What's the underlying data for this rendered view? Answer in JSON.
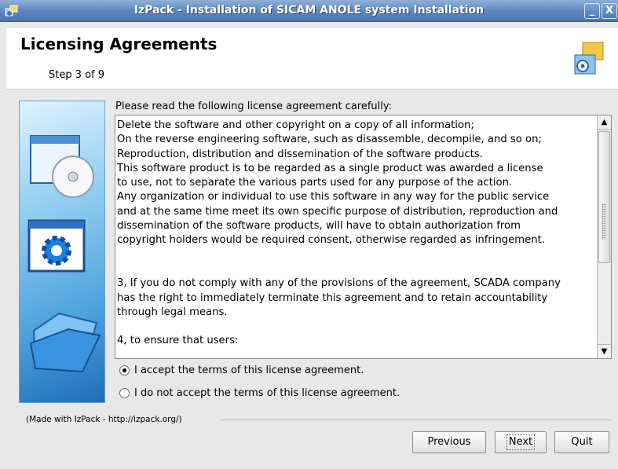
{
  "window": {
    "title": "IzPack - Installation of SICAM ANOLE system Installation",
    "minimize_label": "_",
    "close_label": "X"
  },
  "header": {
    "heading": "Licensing Agreements",
    "step": "Step 3 of 9"
  },
  "license": {
    "intro": "Please read the following license agreement carefully:",
    "text": "Delete the software and other copyright on a copy of all information;\nOn the reverse engineering software, such as disassemble, decompile, and so on;\nReproduction, distribution and dissemination of the software products.\nThis software product is to be regarded as a single product was awarded a license\nto use, not to separate the various parts used for any purpose of the action.\nAny organization or individual to use this software in any way for the public service\nand at the same time meet its own specific purpose of distribution, reproduction and\ndissemination of the software products, will have to obtain authorization from\ncopyright holders would be required consent, otherwise regarded as infringement.\n\n\n3, If you do not comply with any of the provisions of the agreement, SCADA company\nhas the right to immediately terminate this agreement and to retain accountability\nthrough legal means.\n\n4, to ensure that users:"
  },
  "options": {
    "accept_label": "I accept the terms of this license agreement.",
    "reject_label": "I do not accept the terms of this license agreement.",
    "selected": "accept"
  },
  "footer": {
    "made_with": "(Made with IzPack - http://izpack.org/)"
  },
  "buttons": {
    "previous": "Previous",
    "next": "Next",
    "quit": "Quit"
  }
}
